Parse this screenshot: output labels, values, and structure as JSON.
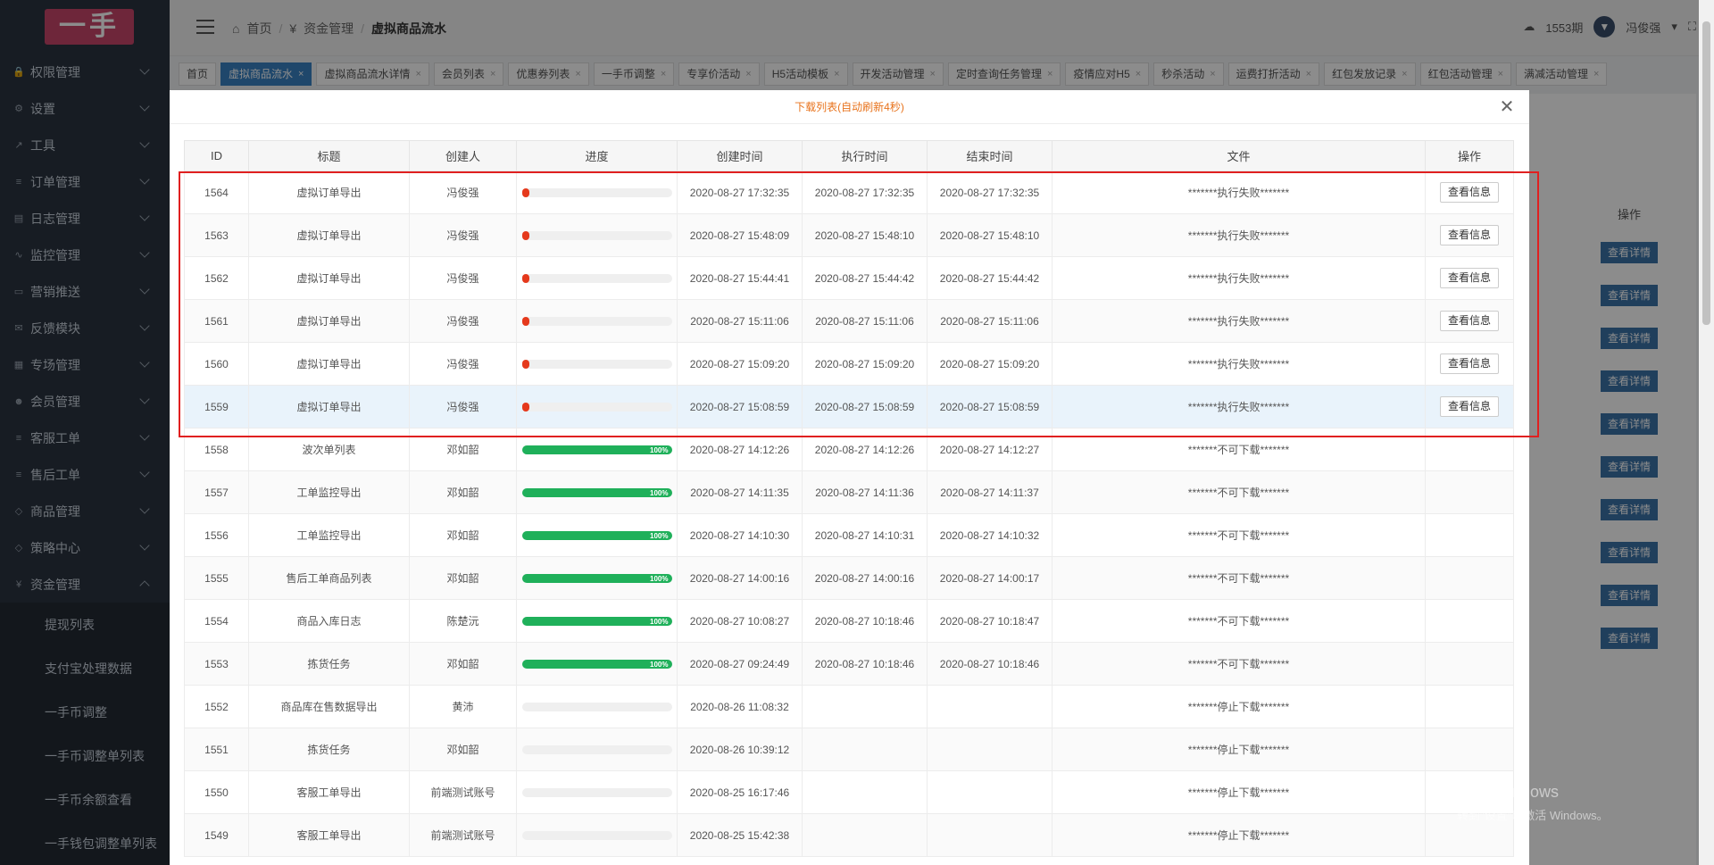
{
  "sidebar": {
    "logo": "一手",
    "menu": [
      {
        "label": "权限管理",
        "icon": "lock-icon"
      },
      {
        "label": "设置",
        "icon": "gear-icon"
      },
      {
        "label": "工具",
        "icon": "wrench-icon"
      },
      {
        "label": "订单管理",
        "icon": "list-icon"
      },
      {
        "label": "日志管理",
        "icon": "file-icon"
      },
      {
        "label": "监控管理",
        "icon": "pulse-icon"
      },
      {
        "label": "营销推送",
        "icon": "card-icon"
      },
      {
        "label": "反馈模块",
        "icon": "mail-icon"
      },
      {
        "label": "专场管理",
        "icon": "table-icon"
      },
      {
        "label": "会员管理",
        "icon": "users-icon"
      },
      {
        "label": "客服工单",
        "icon": "list-icon"
      },
      {
        "label": "售后工单",
        "icon": "list-icon"
      },
      {
        "label": "商品管理",
        "icon": "bag-icon"
      },
      {
        "label": "策略中心",
        "icon": "bag-icon"
      },
      {
        "label": "资金管理",
        "icon": "yen-icon"
      }
    ],
    "submenu": [
      "提现列表",
      "支付宝处理数据",
      "一手币调整",
      "一手币调整单列表",
      "一手币余额查看",
      "一手钱包调整单列表"
    ]
  },
  "header": {
    "breadcrumb": [
      "首页",
      "资金管理",
      "虚拟商品流水"
    ],
    "period": "1553期",
    "user": "冯俊强"
  },
  "tabs": [
    {
      "label": "首页",
      "closable": false,
      "active": false
    },
    {
      "label": "虚拟商品流水",
      "closable": true,
      "active": true
    },
    {
      "label": "虚拟商品流水详情",
      "closable": true,
      "active": false
    },
    {
      "label": "会员列表",
      "closable": true,
      "active": false
    },
    {
      "label": "优惠券列表",
      "closable": true,
      "active": false
    },
    {
      "label": "一手币调整",
      "closable": true,
      "active": false
    },
    {
      "label": "专享价活动",
      "closable": true,
      "active": false
    },
    {
      "label": "H5活动模板",
      "closable": true,
      "active": false
    },
    {
      "label": "开发活动管理",
      "closable": true,
      "active": false
    },
    {
      "label": "定时查询任务管理",
      "closable": true,
      "active": false
    },
    {
      "label": "疫情应对H5",
      "closable": true,
      "active": false
    },
    {
      "label": "秒杀活动",
      "closable": true,
      "active": false
    },
    {
      "label": "运费打折活动",
      "closable": true,
      "active": false
    },
    {
      "label": "红包发放记录",
      "closable": true,
      "active": false
    },
    {
      "label": "红包活动管理",
      "closable": true,
      "active": false
    },
    {
      "label": "满减活动管理",
      "closable": true,
      "active": false
    }
  ],
  "background": {
    "ops_header": "操作",
    "detail_button": "查看详情",
    "detail_count": 10
  },
  "modal": {
    "title": "下载列表(自动刷新4秒)",
    "columns": [
      "ID",
      "标题",
      "创建人",
      "进度",
      "创建时间",
      "执行时间",
      "结束时间",
      "文件",
      "操作"
    ],
    "rows": [
      {
        "id": "1564",
        "title": "虚拟订单导出",
        "creator": "冯俊强",
        "progress": 0.03,
        "pct": "",
        "created": "2020-08-27 17:32:35",
        "executed": "2020-08-27 17:32:35",
        "ended": "2020-08-27 17:32:35",
        "file": "*******执行失败*******",
        "action": "查看信息"
      },
      {
        "id": "1563",
        "title": "虚拟订单导出",
        "creator": "冯俊强",
        "progress": 0.03,
        "pct": "",
        "created": "2020-08-27 15:48:09",
        "executed": "2020-08-27 15:48:10",
        "ended": "2020-08-27 15:48:10",
        "file": "*******执行失败*******",
        "action": "查看信息"
      },
      {
        "id": "1562",
        "title": "虚拟订单导出",
        "creator": "冯俊强",
        "progress": 0.03,
        "pct": "",
        "created": "2020-08-27 15:44:41",
        "executed": "2020-08-27 15:44:42",
        "ended": "2020-08-27 15:44:42",
        "file": "*******执行失败*******",
        "action": "查看信息"
      },
      {
        "id": "1561",
        "title": "虚拟订单导出",
        "creator": "冯俊强",
        "progress": 0.03,
        "pct": "",
        "created": "2020-08-27 15:11:06",
        "executed": "2020-08-27 15:11:06",
        "ended": "2020-08-27 15:11:06",
        "file": "*******执行失败*******",
        "action": "查看信息"
      },
      {
        "id": "1560",
        "title": "虚拟订单导出",
        "creator": "冯俊强",
        "progress": 0.03,
        "pct": "",
        "created": "2020-08-27 15:09:20",
        "executed": "2020-08-27 15:09:20",
        "ended": "2020-08-27 15:09:20",
        "file": "*******执行失败*******",
        "action": "查看信息"
      },
      {
        "id": "1559",
        "title": "虚拟订单导出",
        "creator": "冯俊强",
        "progress": 0.03,
        "pct": "",
        "created": "2020-08-27 15:08:59",
        "executed": "2020-08-27 15:08:59",
        "ended": "2020-08-27 15:08:59",
        "file": "*******执行失败*******",
        "action": "查看信息"
      },
      {
        "id": "1558",
        "title": "波次单列表",
        "creator": "邓如韶",
        "progress": 1,
        "pct": "100%",
        "created": "2020-08-27 14:12:26",
        "executed": "2020-08-27 14:12:26",
        "ended": "2020-08-27 14:12:27",
        "file": "*******不可下载*******",
        "action": ""
      },
      {
        "id": "1557",
        "title": "工单监控导出",
        "creator": "邓如韶",
        "progress": 1,
        "pct": "100%",
        "created": "2020-08-27 14:11:35",
        "executed": "2020-08-27 14:11:36",
        "ended": "2020-08-27 14:11:37",
        "file": "*******不可下载*******",
        "action": ""
      },
      {
        "id": "1556",
        "title": "工单监控导出",
        "creator": "邓如韶",
        "progress": 1,
        "pct": "100%",
        "created": "2020-08-27 14:10:30",
        "executed": "2020-08-27 14:10:31",
        "ended": "2020-08-27 14:10:32",
        "file": "*******不可下载*******",
        "action": ""
      },
      {
        "id": "1555",
        "title": "售后工单商品列表",
        "creator": "邓如韶",
        "progress": 1,
        "pct": "100%",
        "created": "2020-08-27 14:00:16",
        "executed": "2020-08-27 14:00:16",
        "ended": "2020-08-27 14:00:17",
        "file": "*******不可下载*******",
        "action": ""
      },
      {
        "id": "1554",
        "title": "商品入库日志",
        "creator": "陈楚沅",
        "progress": 1,
        "pct": "100%",
        "created": "2020-08-27 10:08:27",
        "executed": "2020-08-27 10:18:46",
        "ended": "2020-08-27 10:18:47",
        "file": "*******不可下载*******",
        "action": ""
      },
      {
        "id": "1553",
        "title": "拣货任务",
        "creator": "邓如韶",
        "progress": 1,
        "pct": "100%",
        "created": "2020-08-27 09:24:49",
        "executed": "2020-08-27 10:18:46",
        "ended": "2020-08-27 10:18:46",
        "file": "*******不可下载*******",
        "action": ""
      },
      {
        "id": "1552",
        "title": "商品库在售数据导出",
        "creator": "黄沛",
        "progress": 0,
        "pct": "",
        "created": "2020-08-26 11:08:32",
        "executed": "",
        "ended": "",
        "file": "*******停止下载*******",
        "action": ""
      },
      {
        "id": "1551",
        "title": "拣货任务",
        "creator": "邓如韶",
        "progress": 0,
        "pct": "",
        "created": "2020-08-26 10:39:12",
        "executed": "",
        "ended": "",
        "file": "*******停止下载*******",
        "action": ""
      },
      {
        "id": "1550",
        "title": "客服工单导出",
        "creator": "前端测试账号",
        "progress": 0,
        "pct": "",
        "created": "2020-08-25 16:17:46",
        "executed": "",
        "ended": "",
        "file": "*******停止下载*******",
        "action": ""
      },
      {
        "id": "1549",
        "title": "客服工单导出",
        "creator": "前端测试账号",
        "progress": 0,
        "pct": "",
        "created": "2020-08-25 15:42:38",
        "executed": "",
        "ended": "",
        "file": "*******停止下载*******",
        "action": ""
      }
    ]
  },
  "watermark": {
    "line1": "激活 Windows",
    "line2": "转到\"设置\"以激活 Windows。"
  },
  "colors": {
    "accent": "#3a82c4",
    "fail": "#e5391c",
    "done": "#1fb05a",
    "title": "#e8731c",
    "highlight_box": "#e02020"
  }
}
